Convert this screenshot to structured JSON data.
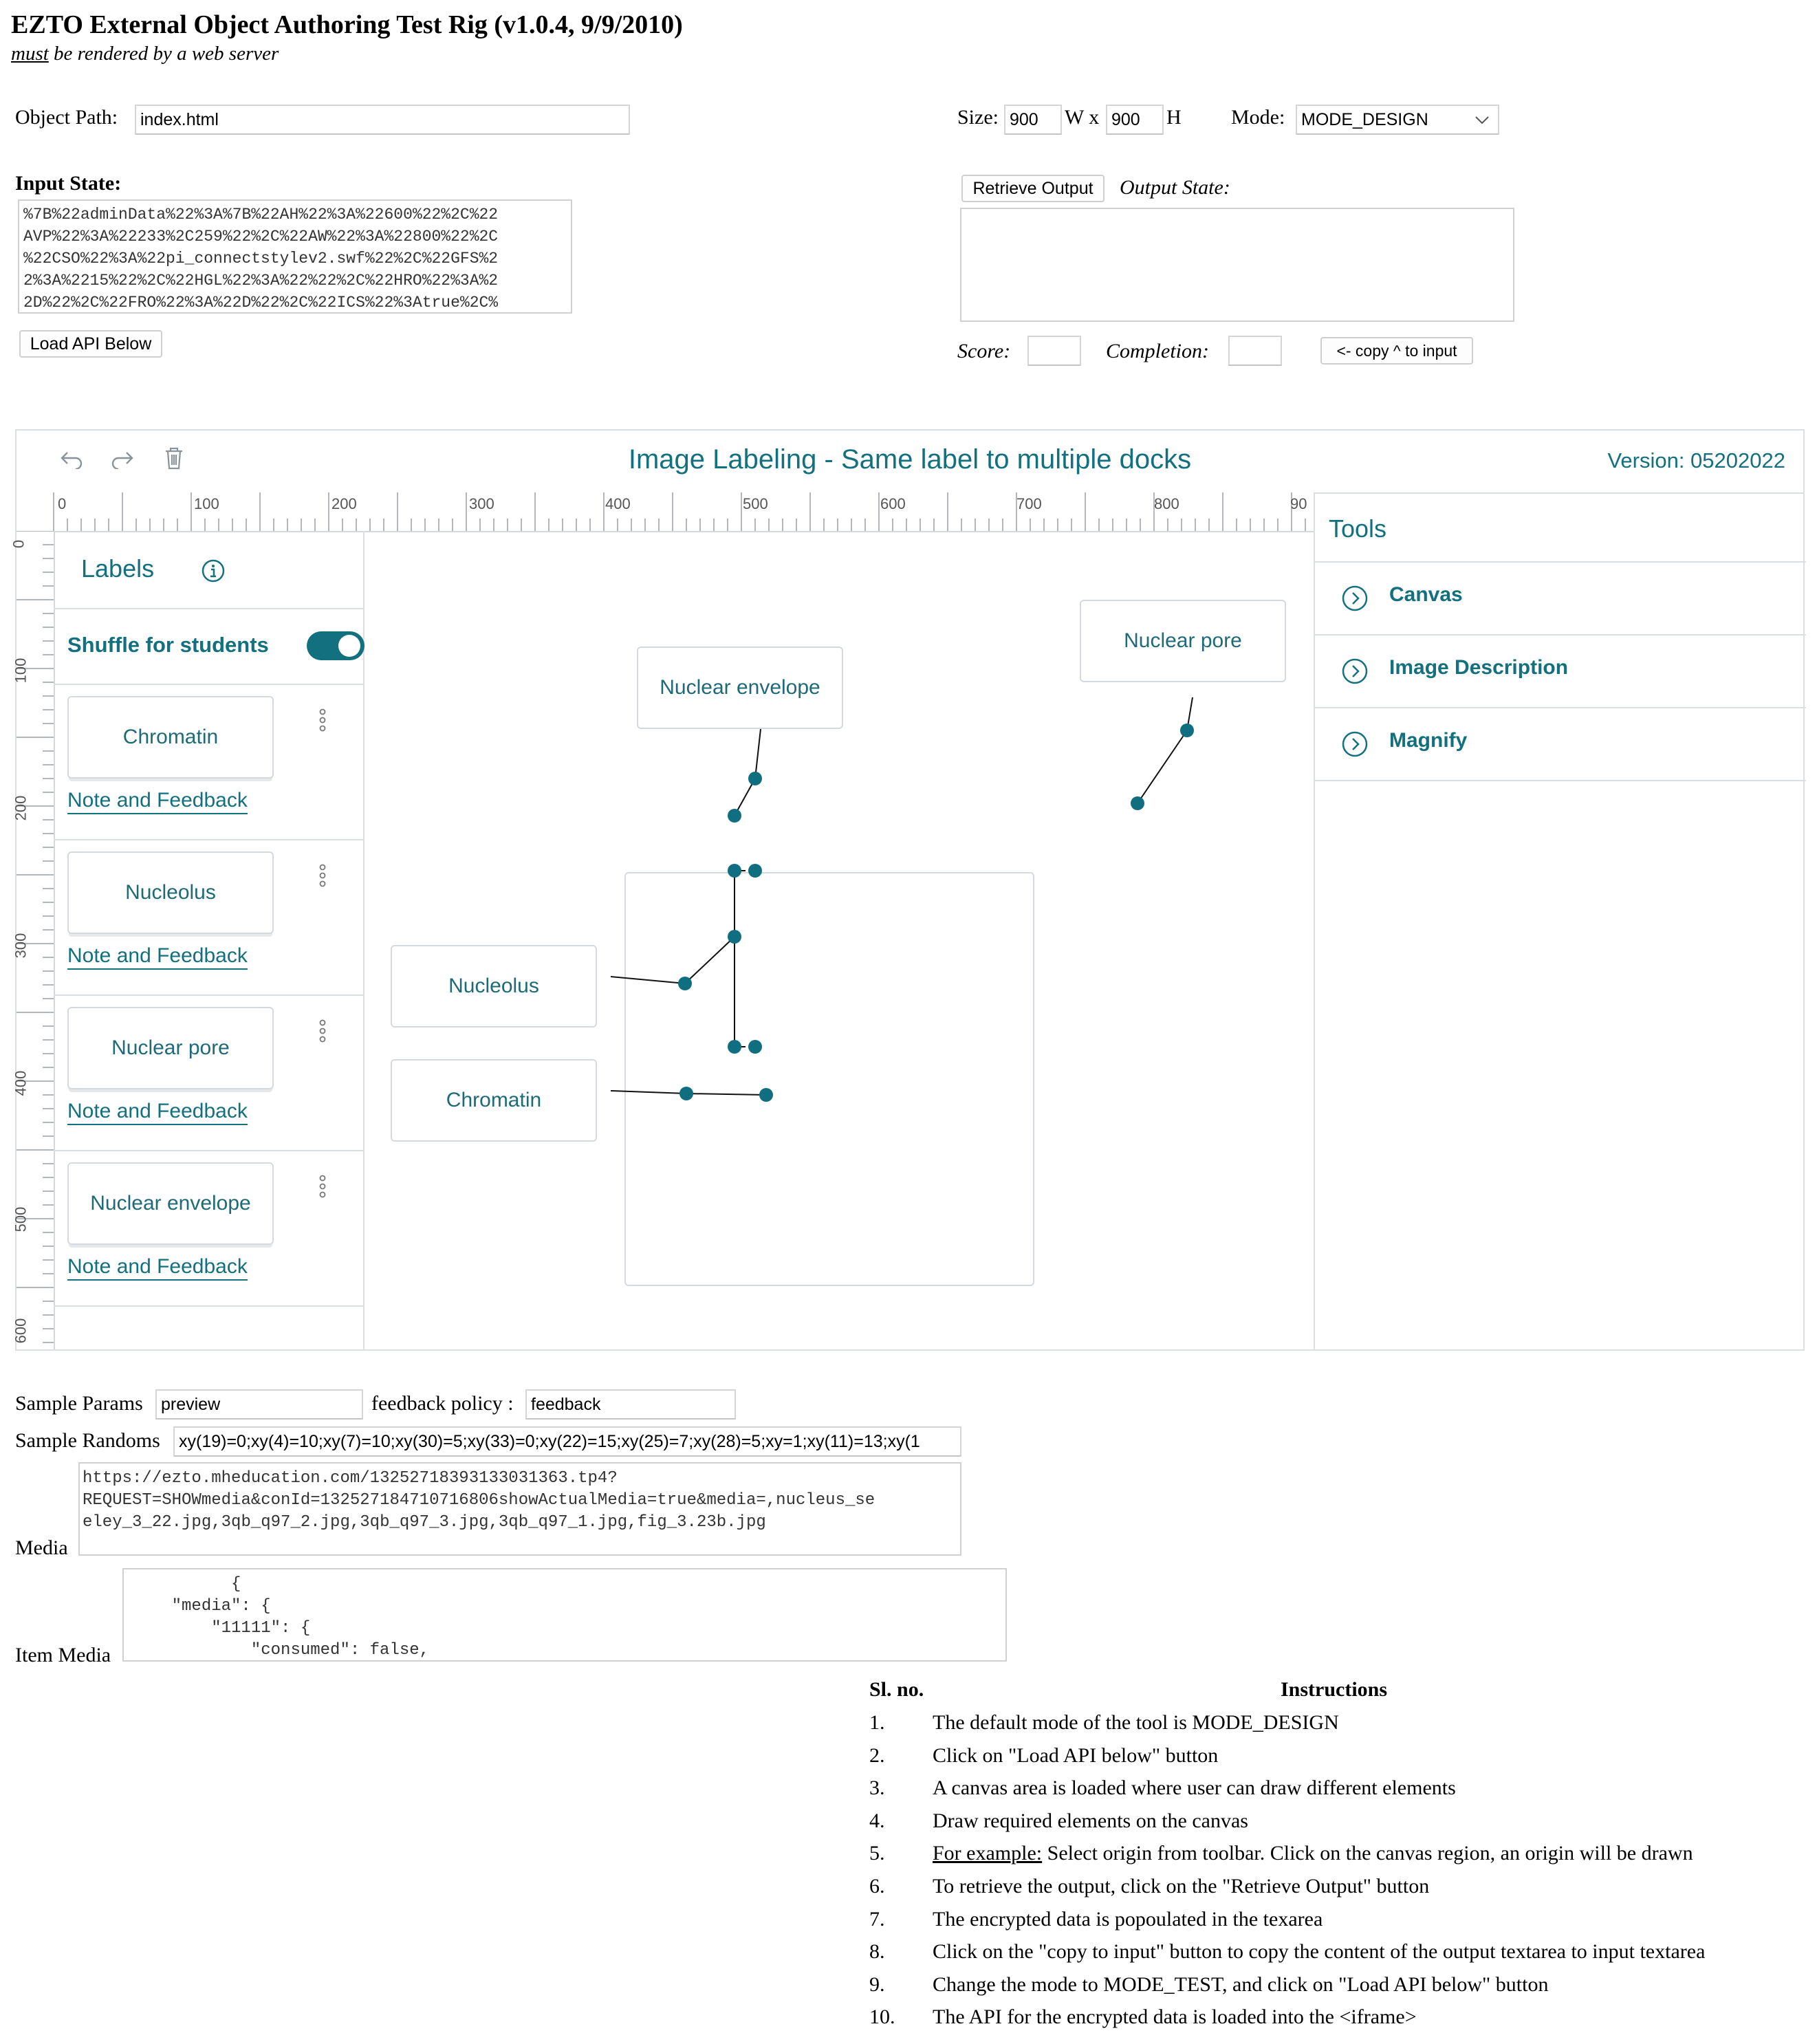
{
  "header": {
    "title": "EZTO External Object Authoring Test Rig (v1.0.4, 9/9/2010)",
    "subtitle_em": "must",
    "subtitle_rest": " be rendered by a web server"
  },
  "config": {
    "object_path_label": "Object Path:",
    "object_path_value": "index.html",
    "size_label": "Size:",
    "width_value": "900",
    "w_label": "W x",
    "height_value": "900",
    "h_label": "H",
    "mode_label": "Mode:",
    "mode_value": "MODE_DESIGN"
  },
  "input_state": {
    "label": "Input State:",
    "text": "%7B%22adminData%22%3A%7B%22AH%22%3A%22600%22%2C%22\nAVP%22%3A%22233%2C259%22%2C%22AW%22%3A%22800%22%2C\n%22CSO%22%3A%22pi_connectstylev2.swf%22%2C%22GFS%2\n2%3A%2215%22%2C%22HGL%22%3A%22%22%2C%22HRO%22%3A%2\n2D%22%2C%22FRO%22%3A%22D%22%2C%22ICS%22%3Atrue%2C%",
    "load_button": "Load API Below"
  },
  "output_state": {
    "retrieve_button": "Retrieve Output",
    "label": "Output State:",
    "text": "",
    "score_label": "Score:",
    "score_value": "",
    "completion_label": "Completion:",
    "completion_value": "",
    "copy_button": "<- copy ^ to input"
  },
  "app": {
    "undo_icon": "undo-icon",
    "redo_icon": "redo-icon",
    "trash_icon": "trash-icon",
    "title": "Image Labeling - Same label to multiple docks",
    "version": "Version: 05202022",
    "ruler_h": [
      "0",
      "100",
      "200",
      "300",
      "400",
      "500",
      "600",
      "700",
      "800",
      "90"
    ],
    "ruler_v": [
      "0",
      "100",
      "200",
      "300",
      "400",
      "500",
      "600"
    ],
    "labels_title": "Labels",
    "info_icon": "info-icon",
    "shuffle_label": "Shuffle for students",
    "shuffle_on": true,
    "label_items": [
      {
        "text": "Chromatin",
        "link": "Note and Feedback"
      },
      {
        "text": "Nucleolus",
        "link": "Note and Feedback"
      },
      {
        "text": "Nuclear pore",
        "link": "Note and Feedback"
      },
      {
        "text": "Nuclear envelope",
        "link": "Note and Feedback"
      }
    ],
    "canvas_cards": {
      "nuclear_envelope": "Nuclear envelope",
      "nuclear_pore": "Nuclear pore",
      "nucleolus": "Nucleolus",
      "chromatin": "Chromatin"
    },
    "tools_title": "Tools",
    "tools": [
      "Canvas",
      "Image Description",
      "Magnify"
    ],
    "accent_color": "#12707f"
  },
  "params": {
    "sample_params_label": "Sample Params",
    "sample_params_value": "preview",
    "feedback_policy_label": "feedback policy :",
    "feedback_policy_value": "feedback",
    "sample_randoms_label": "Sample Randoms",
    "sample_randoms_value": "xy(19)=0;xy(4)=10;xy(7)=10;xy(30)=5;xy(33)=0;xy(22)=15;xy(25)=7;xy(28)=5;xy=1;xy(11)=13;xy(1",
    "media_label": "Media",
    "media_text": "https://ezto.mheducation.com/13252718393133031363.tp4?\nREQUEST=SHOWmedia&conId=132527184710716806showActualMedia=true&media=,nucleus_se\neley_3_22.jpg,3qb_q97_2.jpg,3qb_q97_3.jpg,3qb_q97_1.jpg,fig_3.23b.jpg",
    "item_media_label": "Item Media",
    "item_media_text": "          {\n    \"media\": {\n        \"11111\": {\n            \"consumed\": false,"
  },
  "instructions": {
    "col_no": "Sl. no.",
    "col_instr": "Instructions",
    "rows": [
      {
        "no": "1.",
        "text": "The default mode of the tool is MODE_DESIGN"
      },
      {
        "no": "2.",
        "text": "Click on \"Load API below\" button"
      },
      {
        "no": "3.",
        "text": "A canvas area is loaded where user can draw different elements"
      },
      {
        "no": "4.",
        "text": "Draw required elements on the canvas"
      },
      {
        "no": "5.",
        "lead": "For example:",
        "text": " Select origin from toolbar. Click on the canvas region, an origin will be drawn"
      },
      {
        "no": "6.",
        "text": "To retrieve the output, click on the \"Retrieve Output\" button"
      },
      {
        "no": "7.",
        "text": "The encrypted data is popoulated in the texarea"
      },
      {
        "no": "8.",
        "text": "Click on the \"copy to input\" button to copy the content of the output textarea to input textarea"
      },
      {
        "no": "9.",
        "text": "Change the mode to MODE_TEST, and click on \"Load API below\" button"
      },
      {
        "no": "10.",
        "text": "The API for the encrypted data is loaded into the <iframe>"
      }
    ]
  }
}
